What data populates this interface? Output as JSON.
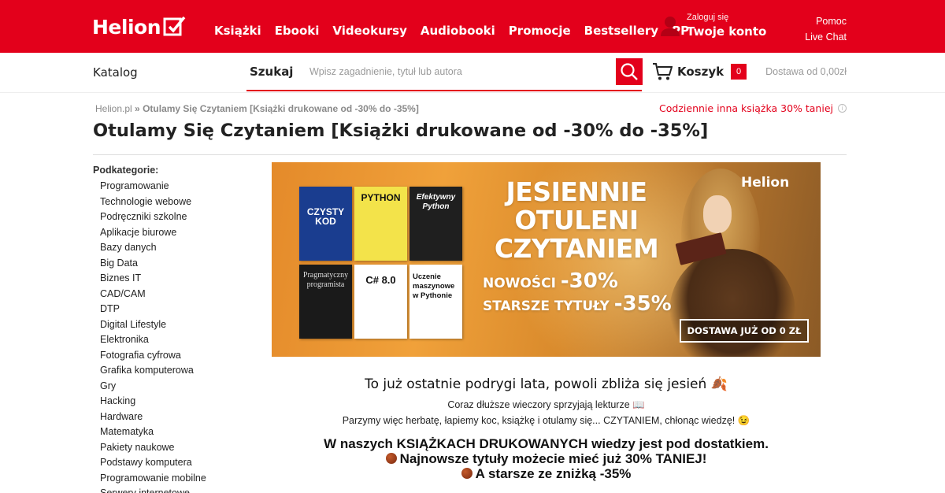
{
  "brand": {
    "name": "Helion",
    "color": "#e3001b"
  },
  "nav": [
    "Książki",
    "Ebooki",
    "Videokursy",
    "Audiobooki",
    "Promocje",
    "Bestsellery",
    "PP"
  ],
  "account": {
    "small": "Zaloguj się",
    "big": "Twoje konto",
    "icon": "user-icon"
  },
  "help": {
    "pomoc": "Pomoc",
    "chat": "Live Chat"
  },
  "catalog_label": "Katalog",
  "search": {
    "label": "Szukaj",
    "placeholder": "Wpisz zagadnienie, tytuł lub autora",
    "icon": "search-icon"
  },
  "cart": {
    "label": "Koszyk",
    "count": "0",
    "icon": "cart-icon"
  },
  "delivery": "Dostawa od 0,00zł",
  "breadcrumb": {
    "home": "Helion.pl",
    "sep": "»",
    "current": "Otulamy Się Czytaniem [Książki drukowane od -30% do -35%]"
  },
  "daily": "Codziennie inna książka 30% taniej",
  "page_title": "Otulamy Się Czytaniem [Książki drukowane od -30% do -35%]",
  "sidebar": {
    "heading": "Podkategorie:",
    "items": [
      "Programowanie",
      "Technologie webowe",
      "Podręczniki szkolne",
      "Aplikacje biurowe",
      "Bazy danych",
      "Big Data",
      "Biznes IT",
      "CAD/CAM",
      "DTP",
      "Digital Lifestyle",
      "Elektronika",
      "Fotografia cyfrowa",
      "Grafika komputerowa",
      "Gry",
      "Hacking",
      "Hardware",
      "Matematyka",
      "Pakiety naukowe",
      "Podstawy komputera",
      "Programowanie mobilne",
      "Serwery internetowe"
    ]
  },
  "banner": {
    "line1": "JESIENNIE",
    "line2": "OTULENI",
    "line3": "CZYTANIEM",
    "promo1_label": "NOWOŚCI",
    "promo1_value": "-30%",
    "promo2_label": "STARSZE TYTUŁY",
    "promo2_value": "-35%",
    "delivery": "DOSTAWA JUŻ OD 0 ZŁ",
    "logo": "Helion",
    "books": [
      {
        "title": "CZYSTY KOD",
        "bg": "#1a3d8f",
        "fg": "#ffffff"
      },
      {
        "title": "PYTHON",
        "bg": "#f3e34a",
        "fg": "#111111"
      },
      {
        "title": "Efektywny Python",
        "bg": "#1f1f1f",
        "fg": "#ffffff"
      },
      {
        "title": "Pragmatyczny programista",
        "bg": "#1a1a1a",
        "fg": "#dddddd"
      },
      {
        "title": "C# 8.0",
        "bg": "#ffffff",
        "fg": "#111111"
      },
      {
        "title": "Uczenie maszynowe w Pythonie",
        "bg": "#ffffff",
        "fg": "#111111"
      }
    ]
  },
  "content": {
    "heading": "To już ostatnie podrygi lata, powoli zbliża się jesień 🍂",
    "line1": "Coraz dłuższe wieczory sprzyjają lekturze 📖",
    "line2": "Parzymy więc herbatę, łapiemy koc, książkę i otulamy się... CZYTANIEM, chłonąc wiedzę! 😉",
    "bold1": "W naszych KSIĄŻKACH DRUKOWANYCH wiedzy jest pod dostatkiem.",
    "bold2": "Najnowsze tytuły możecie mieć już 30% TANIEJ!",
    "bold3": "A starsze ze zniżką -35%"
  }
}
